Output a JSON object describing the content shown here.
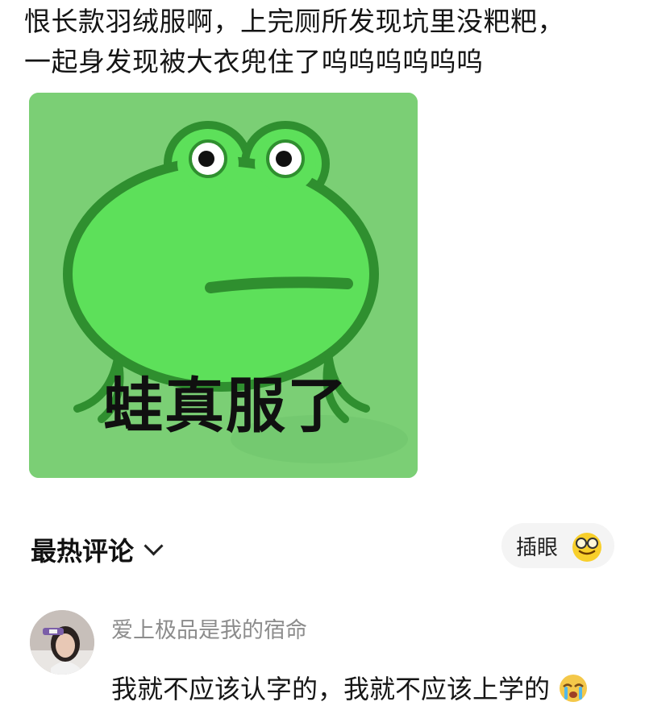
{
  "post": {
    "line1": "恨长款羽绒服啊，上完厕所发现坑里没粑粑，",
    "line2": "一起身发现被大衣兜住了呜呜呜呜呜呜"
  },
  "meme": {
    "caption": "蛙真服了",
    "background_color": "#79cf73",
    "frog_color": "#5fe05c",
    "outline_color": "#2f8f2f"
  },
  "comments": {
    "section_title": "最热评论",
    "sort_icon": "chevron-down-icon",
    "insert_label": "插眼",
    "insert_icon": "smiling-face-with-glasses-icon",
    "items": [
      {
        "username": "爱上极品是我的宿命",
        "text": "我就不应该认字的，我就不应该上学的",
        "emoji_icon": "crying-face-icon",
        "avatar_icon": "user-avatar-photo"
      }
    ]
  }
}
